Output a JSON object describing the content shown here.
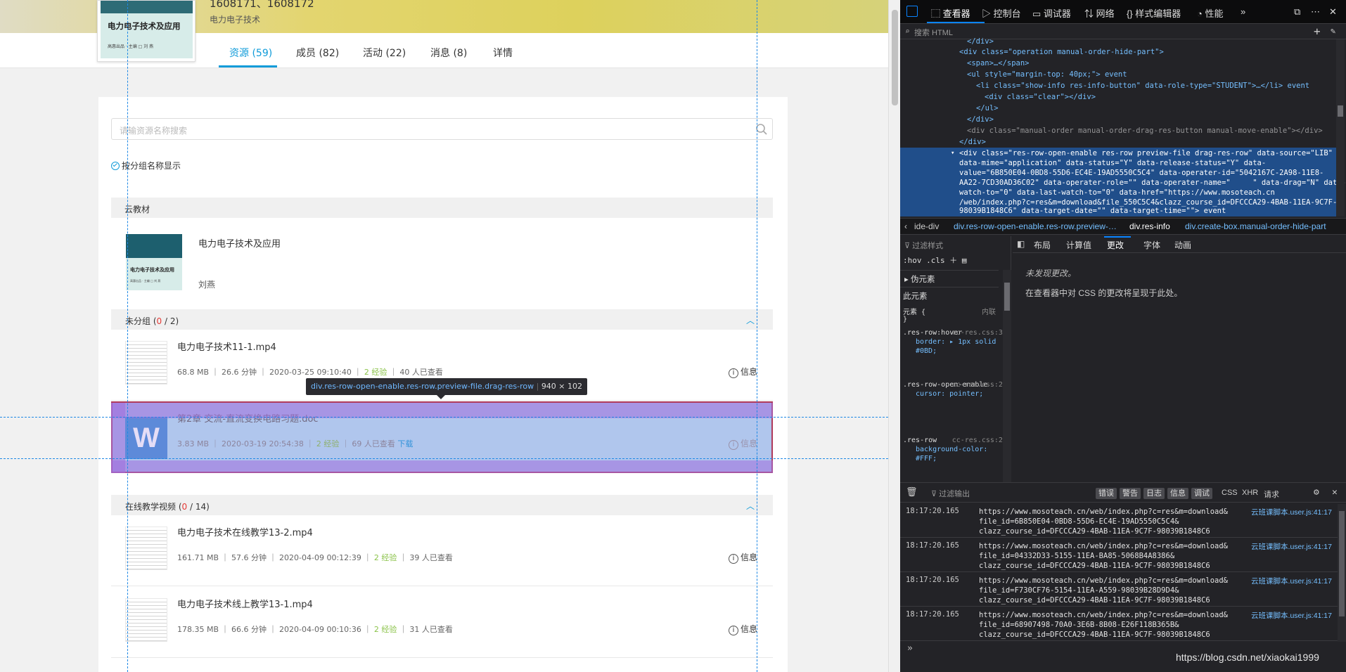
{
  "course": {
    "code": "1608171、1608172",
    "subtitle": "电力电子技术",
    "cover_title": "电力电子技术及应用",
    "cover_sub": "高惠出品 · 主编 □ 刘 燕"
  },
  "tabs": [
    {
      "label": "资源 (59)"
    },
    {
      "label": "成员 (82)"
    },
    {
      "label": "活动 (22)"
    },
    {
      "label": "消息 (8)"
    },
    {
      "label": "详情"
    }
  ],
  "search": {
    "placeholder": "请输资源名称搜索"
  },
  "group_toggle": "按分组名称显示",
  "textbook": {
    "header": "云教材",
    "title": "电力电子技术及应用",
    "author": "刘燕",
    "cover_title": "电力电子技术及应用",
    "cover_sub": "高惠出品 · 主编 □ 刘 燕"
  },
  "groups": [
    {
      "name": "未分组 (",
      "done": "0",
      "total": " / 2)"
    },
    {
      "name": "在线教学视频 (",
      "done": "0",
      "total": " / 14)"
    }
  ],
  "rows": [
    {
      "title": "电力电子技术11-1.mp4",
      "size": "68.8 MB",
      "duration": "26.6 分钟",
      "date": "2020-03-25 09:10:40",
      "exp": "2 经验",
      "views": "40 人已查看",
      "info": "信息"
    },
    {
      "title": "第2章 交流-直流变换电路习题.doc",
      "size": "3.83 MB",
      "duration": "",
      "date": "2020-03-19 20:54:38",
      "exp": "2 经验",
      "views": "69 人已查看",
      "download": "下载",
      "info": "信息"
    },
    {
      "title": "电力电子技术在线教学13-2.mp4",
      "size": "161.71 MB",
      "duration": "57.6 分钟",
      "date": "2020-04-09 00:12:39",
      "exp": "2 经验",
      "views": "39 人已查看",
      "info": "信息"
    },
    {
      "title": "电力电子技术线上教学13-1.mp4",
      "size": "178.35 MB",
      "duration": "66.6 分钟",
      "date": "2020-04-09 00:10:36",
      "exp": "2 经验",
      "views": "31 人已查看",
      "info": "信息"
    }
  ],
  "tooltip": {
    "selector": "div.res-row-open-enable.res-row.preview-file.drag-res-row",
    "dims": "940 × 102"
  },
  "doc_icon": "W",
  "devtools": {
    "tabs": [
      "查看器",
      "控制台",
      "调试器",
      "网络",
      "样式编辑器",
      "性能"
    ],
    "search_placeholder": "搜索 HTML",
    "html_lines": [
      "</div>",
      "<div class=\"operation manual-order-hide-part\">",
      "<span>…</span>",
      "<ul style=\"margin-top: 40px;\"> event",
      "<li class=\"show-info res-info-button\" data-role-type=\"STUDENT\">…</li> event",
      "<div class=\"clear\"></div>",
      "</ul>",
      "</div>",
      "<div class=\"manual-order manual-order-drag-res-button manual-move-enable\"></div>",
      "</div>"
    ],
    "selected_node": [
      "<div class=\"res-row-open-enable res-row preview-file drag-res-row\" data-source=\"LIB\"",
      "data-mime=\"application\" data-status=\"Y\" data-release-status=\"Y\" data-",
      "value=\"6B850E04-0BD8-55D6-EC4E-19AD5550C5C4\" data-operater-id=\"5042167C-2A98-11E8-",
      "AA22-7CD30AD36C02\" data-operater-role=\"\" data-operater-name=\"     \" data-drag=\"N\" data-",
      "watch-to=\"0\" data-last-watch-to=\"0\" data-href=\"https://www.mosoteach.cn",
      "/web/index.php?c=res&m=download&file_550C5C4&clazz_course_id=DFCCCA29-4BAB-11EA-9C7F-",
      "98039B1848C6\" data-target-date=\"\" data-target-time=\"\"> event"
    ],
    "breadcrumbs": [
      "ide-div",
      "div.res-row-open-enable.res-row.preview-…",
      "div.res-info",
      "div.create-box.manual-order-hide-part"
    ],
    "rules_filter": "过滤样式",
    "rules_tools": ":hov .cls",
    "pseudo": "伪元素",
    "this_element": "此元素",
    "element_rule": "元素 {",
    "inline": "内联",
    "css_rules": [
      {
        "selector": ".res-row:hover",
        "source": "cc-res.css:303",
        "decl": "border: ▸ 1px solid #0BD;"
      },
      {
        "selector": ".res-row-open-enable",
        "source": "cc-res.css:286",
        "decl": "cursor: pointer;"
      },
      {
        "selector": ".res-row",
        "source": "cc-res.css:276",
        "decl": "background-color: #FFF;"
      }
    ],
    "layout_tabs": [
      "布局",
      "计算值",
      "更改",
      "字体",
      "动画"
    ],
    "no_changes": "未发现更改。",
    "changes_hint": "在查看器中对 CSS 的更改将呈现于此处。",
    "console_filter": "过滤输出",
    "console_buttons": [
      "错误",
      "警告",
      "日志",
      "信息",
      "调试"
    ],
    "console_types": [
      "CSS",
      "XHR",
      "请求"
    ],
    "logs": [
      {
        "time": "18:17:20.165",
        "url": "https://www.mosoteach.cn/web/index.php?c=res&m=download&\nfile_id=6B850E04-0BD8-55D6-EC4E-19AD5550C5C4&\nclazz_course_id=DFCCCA29-4BAB-11EA-9C7F-98039B1848C6",
        "src": "云班课脚本.user.js:41:17"
      },
      {
        "time": "18:17:20.165",
        "url": "https://www.mosoteach.cn/web/index.php?c=res&m=download&\nfile_id=04332D33-5155-11EA-BA85-5068B4A8386&\nclazz_course_id=DFCCCA29-4BAB-11EA-9C7F-98039B1848C6",
        "src": "云班课脚本.user.js:41:17"
      },
      {
        "time": "18:17:20.165",
        "url": "https://www.mosoteach.cn/web/index.php?c=res&m=download&\nfile_id=F730CF76-5154-11EA-A559-98039B28D9D4&\nclazz_course_id=DFCCCA29-4BAB-11EA-9C7F-98039B1848C6",
        "src": "云班课脚本.user.js:41:17"
      },
      {
        "time": "18:17:20.165",
        "url": "https://www.mosoteach.cn/web/index.php?c=res&m=download&\nfile_id=68907498-70A0-3E6B-8B08-E26F118B365B&\nclazz_course_id=DFCCCA29-4BAB-11EA-9C7F-98039B1848C6",
        "src": "云班课脚本.user.js:41:17"
      }
    ],
    "watermark": "https://blog.csdn.net/xiaokai1999"
  }
}
